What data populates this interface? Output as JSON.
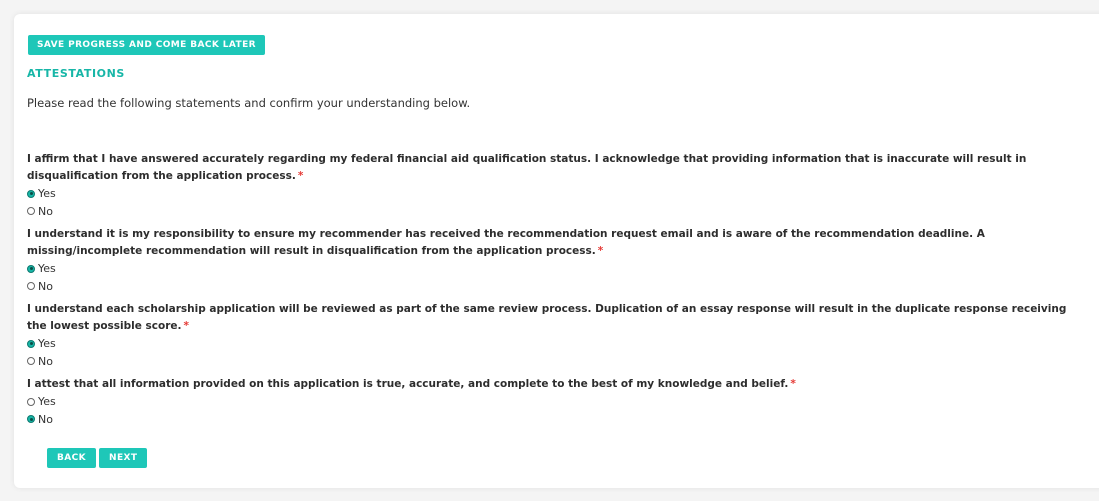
{
  "toolbar": {
    "save_label": "SAVE PROGRESS AND COME BACK LATER"
  },
  "section": {
    "title": "ATTESTATIONS",
    "intro": "Please read the following statements and confirm your understanding below."
  },
  "questions": [
    {
      "text": "I affirm that I have answered accurately regarding my federal financial aid qualification status. I acknowledge that providing information that is inaccurate will result in disqualification from the application process.",
      "required_mark": "*",
      "options": [
        {
          "label": "Yes",
          "selected": true
        },
        {
          "label": "No",
          "selected": false
        }
      ]
    },
    {
      "text": "I understand it is my responsibility to ensure my recommender has received the recommendation request email and is aware of the recommendation deadline. A missing/incomplete recommendation will result in disqualification from the application process.",
      "required_mark": "*",
      "options": [
        {
          "label": "Yes",
          "selected": true
        },
        {
          "label": "No",
          "selected": false
        }
      ]
    },
    {
      "text": "I understand each scholarship application will be reviewed as part of the same review process. Duplication of an essay response will result in the duplicate response receiving the lowest possible score.",
      "required_mark": "*",
      "options": [
        {
          "label": "Yes",
          "selected": true
        },
        {
          "label": "No",
          "selected": false
        }
      ]
    },
    {
      "text": "I attest that all information provided on this application is true, accurate, and complete to the best of my knowledge and belief.",
      "required_mark": "*",
      "options": [
        {
          "label": "Yes",
          "selected": false
        },
        {
          "label": "No",
          "selected": true
        }
      ]
    }
  ],
  "nav": {
    "back_label": "BACK",
    "next_label": "NEXT"
  },
  "colors": {
    "accent": "#1ec7b8",
    "accent_text": "#17b6a7",
    "required": "#e53935"
  }
}
